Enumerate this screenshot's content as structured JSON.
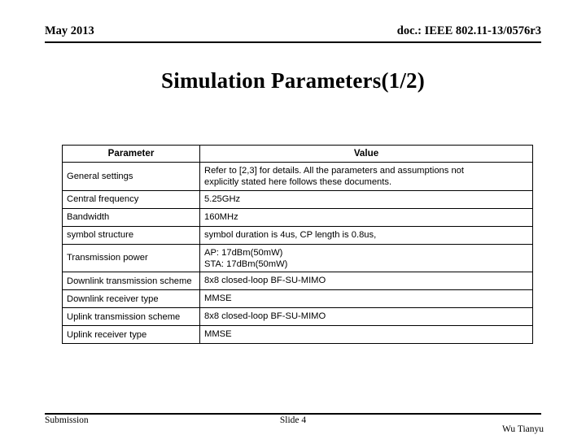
{
  "header": {
    "date": "May 2013",
    "doc_reference": "doc.: IEEE 802.11-13/0576r3"
  },
  "title": "Simulation Parameters(1/2)",
  "table": {
    "columns": [
      "Parameter",
      "Value"
    ],
    "rows": [
      {
        "parameter": "General settings",
        "value_lines": [
          "Refer to [2,3] for details. All the parameters and assumptions not",
          "explicitly stated here follows these documents."
        ]
      },
      {
        "parameter": "Central frequency",
        "value_lines": [
          "5.25GHz"
        ]
      },
      {
        "parameter": "Bandwidth",
        "value_lines": [
          "160MHz"
        ]
      },
      {
        "parameter": "symbol structure",
        "value_lines": [
          "symbol duration is 4us, CP length is 0.8us,"
        ]
      },
      {
        "parameter": "Transmission power",
        "value_lines": [
          "AP: 17dBm(50mW)",
          "STA: 17dBm(50mW)"
        ]
      },
      {
        "parameter": "Downlink transmission scheme",
        "value_lines": [
          "8x8 closed-loop BF-SU-MIMO"
        ]
      },
      {
        "parameter": "Downlink receiver type",
        "value_lines": [
          "MMSE"
        ]
      },
      {
        "parameter": "Uplink transmission scheme",
        "value_lines": [
          "8x8 closed-loop BF-SU-MIMO"
        ]
      },
      {
        "parameter": "Uplink receiver type",
        "value_lines": [
          "MMSE"
        ]
      }
    ]
  },
  "footer": {
    "left": "Submission",
    "center": "Slide 4",
    "right": "Wu Tianyu"
  }
}
